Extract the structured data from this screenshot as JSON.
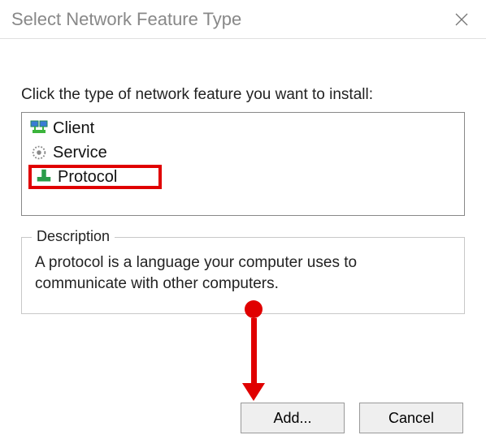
{
  "titlebar": {
    "title": "Select Network Feature Type",
    "close_icon": "×"
  },
  "instruction": "Click the type of network feature you want to install:",
  "features": {
    "items": [
      {
        "label": "Client"
      },
      {
        "label": "Service"
      },
      {
        "label": "Protocol"
      }
    ]
  },
  "description": {
    "legend": "Description",
    "text": "A protocol is a language your computer uses to communicate with other computers."
  },
  "buttons": {
    "add": "Add...",
    "cancel": "Cancel"
  }
}
